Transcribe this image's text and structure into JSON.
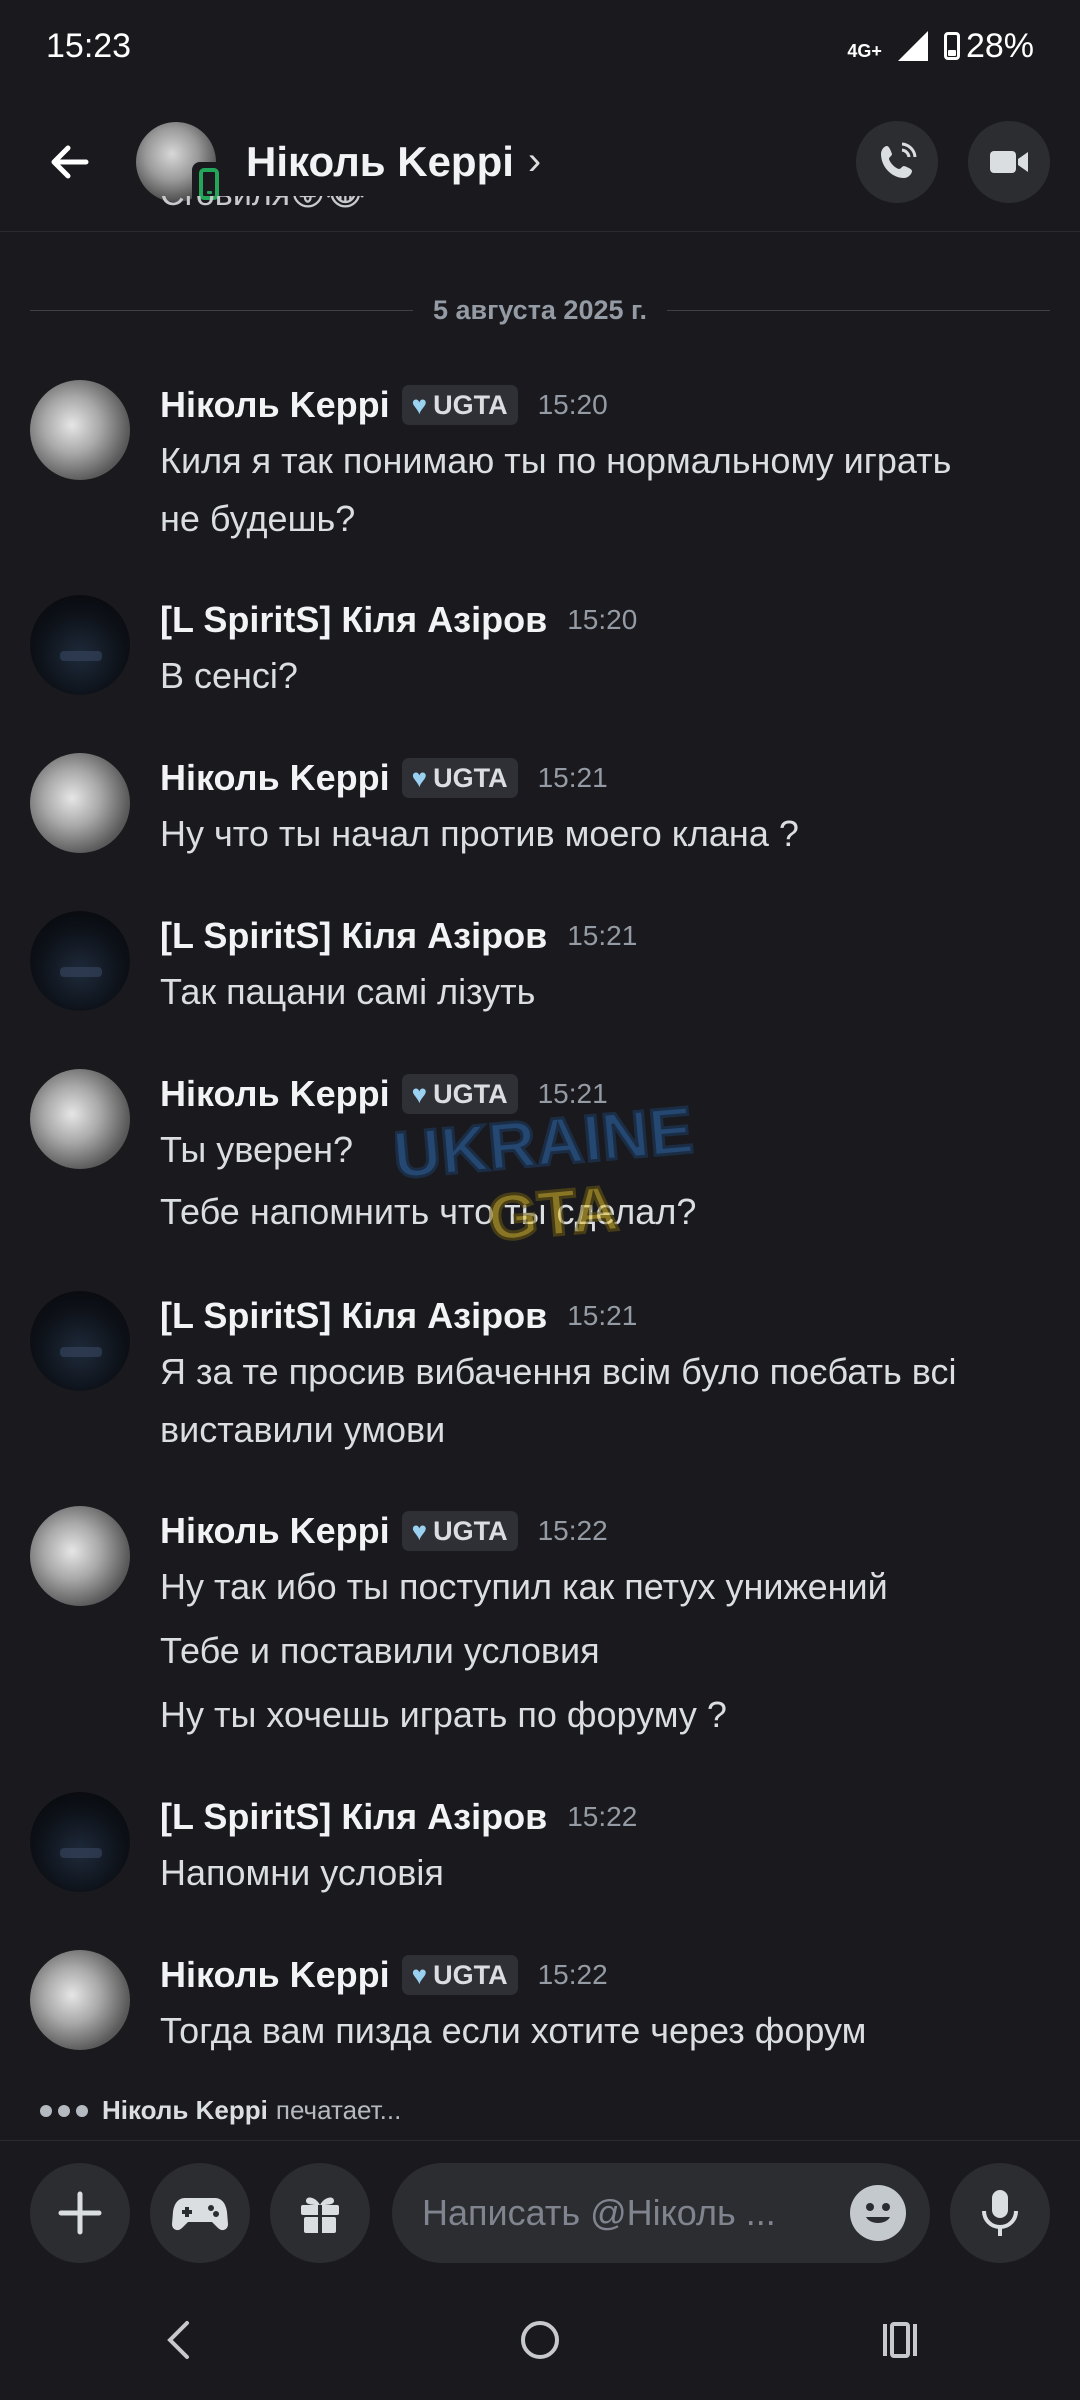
{
  "status": {
    "time": "15:23",
    "network": "4G+",
    "battery": "28%"
  },
  "header": {
    "name": "Ніколь Keppi"
  },
  "partial_prev_message": "Croвиля😜😂",
  "date_divider": "5 августа 2025 г.",
  "messages": [
    {
      "author": "Ніколь Keppi",
      "tag": "UGTA",
      "time": "15:20",
      "lines": [
        "Киля я так понимаю ты по нормальному играть",
        "не будешь?"
      ]
    },
    {
      "author": "[L SpiritS] Кіля Азіров",
      "time": "15:20",
      "lines": [
        "В сенсі?"
      ]
    },
    {
      "author": "Ніколь Keppi",
      "tag": "UGTA",
      "time": "15:21",
      "lines": [
        "Ну что ты начал против моего клана ?"
      ]
    },
    {
      "author": "[L SpiritS] Кіля Азіров",
      "time": "15:21",
      "lines": [
        "Так пацани самі лізуть"
      ]
    },
    {
      "author": "Ніколь Keppi",
      "tag": "UGTA",
      "time": "15:21",
      "lines": [
        "Ты уверен?",
        "Тебе напомнить что ты сделал?"
      ]
    },
    {
      "author": "[L SpiritS] Кіля Азіров",
      "time": "15:21",
      "lines": [
        "Я за те просив вибачення всім було поєбать всі",
        "виставили умови"
      ]
    },
    {
      "author": "Ніколь Keppi",
      "tag": "UGTA",
      "time": "15:22",
      "lines": [
        "Ну так ибо ты поступил как петух унижений",
        "Тебе и поставили условия",
        "Ну ты хочешь играть по форуму ?"
      ]
    },
    {
      "author": "[L SpiritS] Кіля Азіров",
      "time": "15:22",
      "lines": [
        "Напомни условія"
      ]
    },
    {
      "author": "Ніколь Keppi",
      "tag": "UGTA",
      "time": "15:22",
      "lines": [
        "Тогда вам пизда если хотите через форум"
      ]
    }
  ],
  "watermark": {
    "line1": "UKRAINE",
    "line2": "GTA"
  },
  "typing": {
    "name": "Ніколь Keppi",
    "text": "печатает..."
  },
  "input": {
    "placeholder": "Написать @Ніколь ..."
  },
  "colors": {
    "background": "#1a1a1e",
    "surface": "#2b2d31",
    "online": "#23a55a"
  }
}
